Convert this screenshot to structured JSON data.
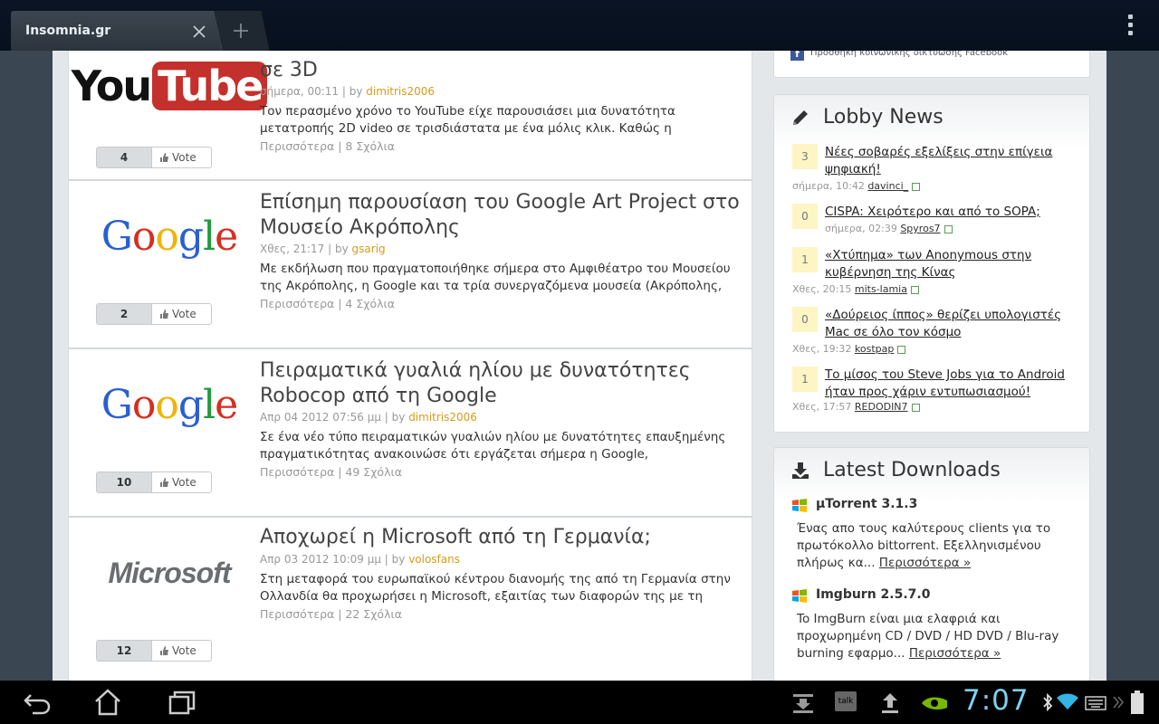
{
  "browser": {
    "tab_title": "Insomnia.gr"
  },
  "articles": [
    {
      "logo": "YouTube",
      "logo_parts": [
        "You",
        "Tube"
      ],
      "title": "σε 3D",
      "time": "σήμερα, 00:11",
      "by": " | by ",
      "author": "dimitris2006",
      "text": "Τον περασμένο χρόνο το YouTube είχε παρουσιάσει μια δυνατότητα μετατροπής 2D video σε τρισδιάστατα με ένα μόλις κλικ. Καθώς η λειτουργία αυτή βρίσκεται",
      "more": "Περισσότερα | 8 Σχόλια",
      "votes": "4",
      "vote_label": "Vote"
    },
    {
      "logo": "Google",
      "title": "Επίσημη παρουσίαση του Google Art Project στο Μουσείο Ακρόπολης",
      "time": "Χθες, 21:17",
      "by": " | by ",
      "author": "gsarig",
      "text": "Με εκδήλωση που πραγματοποιήθηκε σήμερα στο Αμφιθέατρο του Μουσείου της Ακρόπολης, η Google και τα τρία συνεργαζόμενα μουσεία (Ακρόπολης, Μπενάκη",
      "more": "Περισσότερα | 4 Σχόλια",
      "votes": "2",
      "vote_label": "Vote"
    },
    {
      "logo": "Google",
      "title": "Πειραματικά γυαλιά ηλίου με δυνατότητες Robocop από τη Google",
      "time": "Απρ 04 2012 07:56 μμ",
      "by": " | by ",
      "author": "dimitris2006",
      "text": "Σε ένα νέο τύπο πειραματικών γυαλιών ηλίου με δυνατότητες επαυξημένης πραγματικότητας ανακοινώσε ότι εργάζεται σήμερα η Google, επιβεβαιώνοντας",
      "more": "Περισσότερα | 49 Σχόλια",
      "votes": "10",
      "vote_label": "Vote"
    },
    {
      "logo": "Microsoft",
      "title": "Αποχωρεί η Microsoft από τη Γερμανία;",
      "time": "Απρ 03 2012 10:09 μμ",
      "by": " | by ",
      "author": "volosfans",
      "text": "Στη μεταφορά του ευρωπαϊκού κέντρου διανομής της από τη Γερμανία στην Ολλανδία θα προχωρήσει η Microsoft, εξαιτίας των διαφορών της με τη Motorola",
      "more": "Περισσότερα | 22 Σχόλια",
      "votes": "12",
      "vote_label": "Vote"
    }
  ],
  "sidebar": {
    "facebook_text": "Προσθήκη κοινωνικής δικτύωσης Facebook",
    "lobby_title": "Lobby News",
    "news": [
      {
        "count": "3",
        "title": "Νέες σοβαρές εξελίξεις στην επίγεια ψηφιακή!",
        "time": "σήμερα, 10:42",
        "user": "davinci_"
      },
      {
        "count": "0",
        "title": "CISPA: Χειρότερο και από το SOPA;",
        "time": "σήμερα, 02:39",
        "user": "Spyros7"
      },
      {
        "count": "1",
        "title": "«Χτύπημα» των Anonymous στην κυβέρνηση της Κίνας",
        "time": "Χθες, 20:15",
        "user": "mits-lamia"
      },
      {
        "count": "0",
        "title": "«Δούρειος ίππος» θερίζει υπολογιστές Mac σε όλο τον κόσμο",
        "time": "Χθες, 19:32",
        "user": "kostpap"
      },
      {
        "count": "1",
        "title": "Το μίσος του Steve Jobs για το Android ήταν προς χάριν εντυπωσιασμού!",
        "time": "Χθες, 17:57",
        "user": "REDODIN7"
      }
    ],
    "downloads_title": "Latest Downloads",
    "downloads": [
      {
        "name": "µTorrent 3.1.3",
        "desc": "Ένας απο τους καλύτερους clients για το πρωτόκολλο bittorrent. Εξελληνισμένου πλήρως κα...",
        "more": "Περισσότερα »"
      },
      {
        "name": "Imgburn 2.5.7.0",
        "desc": "To ImgBurn είναι μια ελαφριά και προχωρημένη CD / DVD / HD DVD / Blu-ray burning εφαρμο...",
        "more": "Περισσότερα »"
      }
    ]
  },
  "system_bar": {
    "clock": "7:07",
    "talk_label": "talk",
    "colors": {
      "clock": "#7ed0f0",
      "accent_author": "#d89a1a"
    }
  }
}
